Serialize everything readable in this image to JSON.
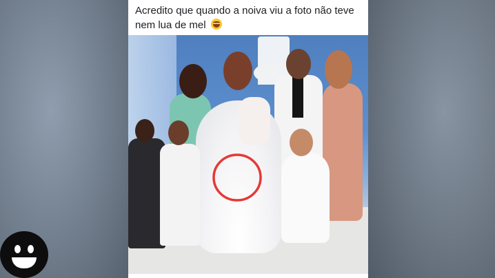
{
  "post": {
    "caption": "Acredito que quando a noiva viu a foto não teve nem lua de mel",
    "caption_emoji": "laughing-face-emoji"
  },
  "photo": {
    "description_icon": "wedding-group-photo",
    "highlight_color": "#e53935"
  },
  "overlay": {
    "reaction_icon": "smiley-face-icon"
  }
}
